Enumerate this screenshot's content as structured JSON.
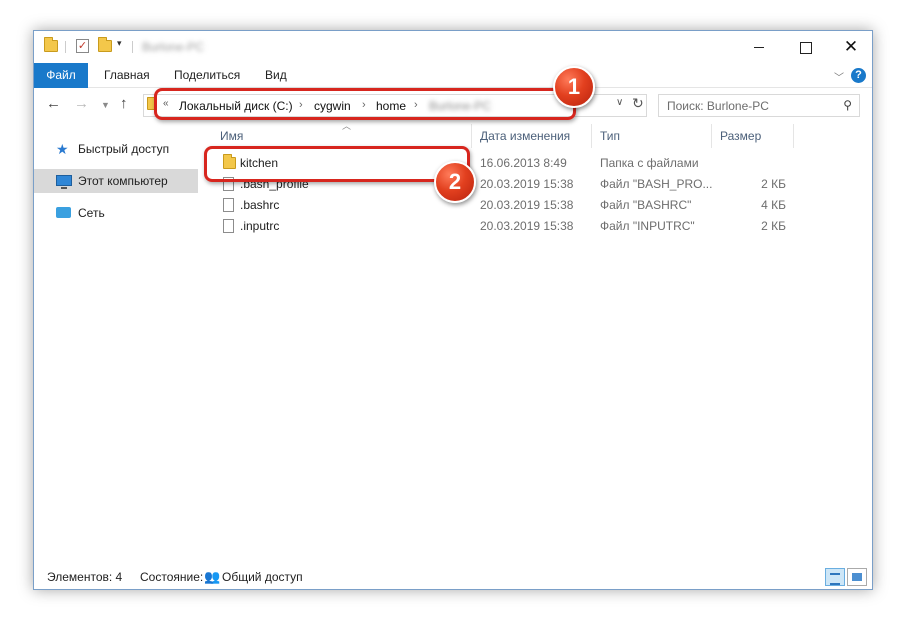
{
  "window": {
    "title_blurred": "Burlone-PC",
    "controls": {
      "minimize": "",
      "maximize": "",
      "close": "✕"
    }
  },
  "ribbon": {
    "tabs": [
      {
        "label": "Файл",
        "active": true
      },
      {
        "label": "Главная"
      },
      {
        "label": "Поделиться"
      },
      {
        "label": "Вид"
      }
    ],
    "help": "?"
  },
  "address_bar": {
    "overflow": "«",
    "crumbs": [
      "Локальный диск (C:)",
      "cygwin",
      "home",
      "Burlone-PC"
    ],
    "separator": "›"
  },
  "search": {
    "placeholder": "Поиск: Burlone-PC"
  },
  "sidebar": {
    "items": [
      {
        "label": "Быстрый доступ",
        "icon": "star-icon"
      },
      {
        "label": "Этот компьютер",
        "icon": "computer-icon",
        "selected": true
      },
      {
        "label": "Сеть",
        "icon": "network-icon"
      }
    ]
  },
  "columns": [
    "Имя",
    "Дата изменения",
    "Тип",
    "Размер"
  ],
  "files": [
    {
      "name": "kitchen",
      "date": "16.06.2013 8:49",
      "type": "Папка с файлами",
      "size": "",
      "kind": "folder"
    },
    {
      "name": ".bash_profile",
      "date": "20.03.2019 15:38",
      "type": "Файл \"BASH_PRO...",
      "size": "2 КБ",
      "kind": "file"
    },
    {
      "name": ".bashrc",
      "date": "20.03.2019 15:38",
      "type": "Файл \"BASHRC\"",
      "size": "4 КБ",
      "kind": "file"
    },
    {
      "name": ".inputrc",
      "date": "20.03.2019 15:38",
      "type": "Файл \"INPUTRC\"",
      "size": "2 КБ",
      "kind": "file"
    }
  ],
  "status": {
    "count": "Элементов: 4",
    "state_label": "Состояние:",
    "state_value": "Общий доступ"
  },
  "annotations": {
    "badge1": "1",
    "badge2": "2"
  },
  "colors": {
    "accent": "#1979ca",
    "callout": "#d7261e"
  }
}
